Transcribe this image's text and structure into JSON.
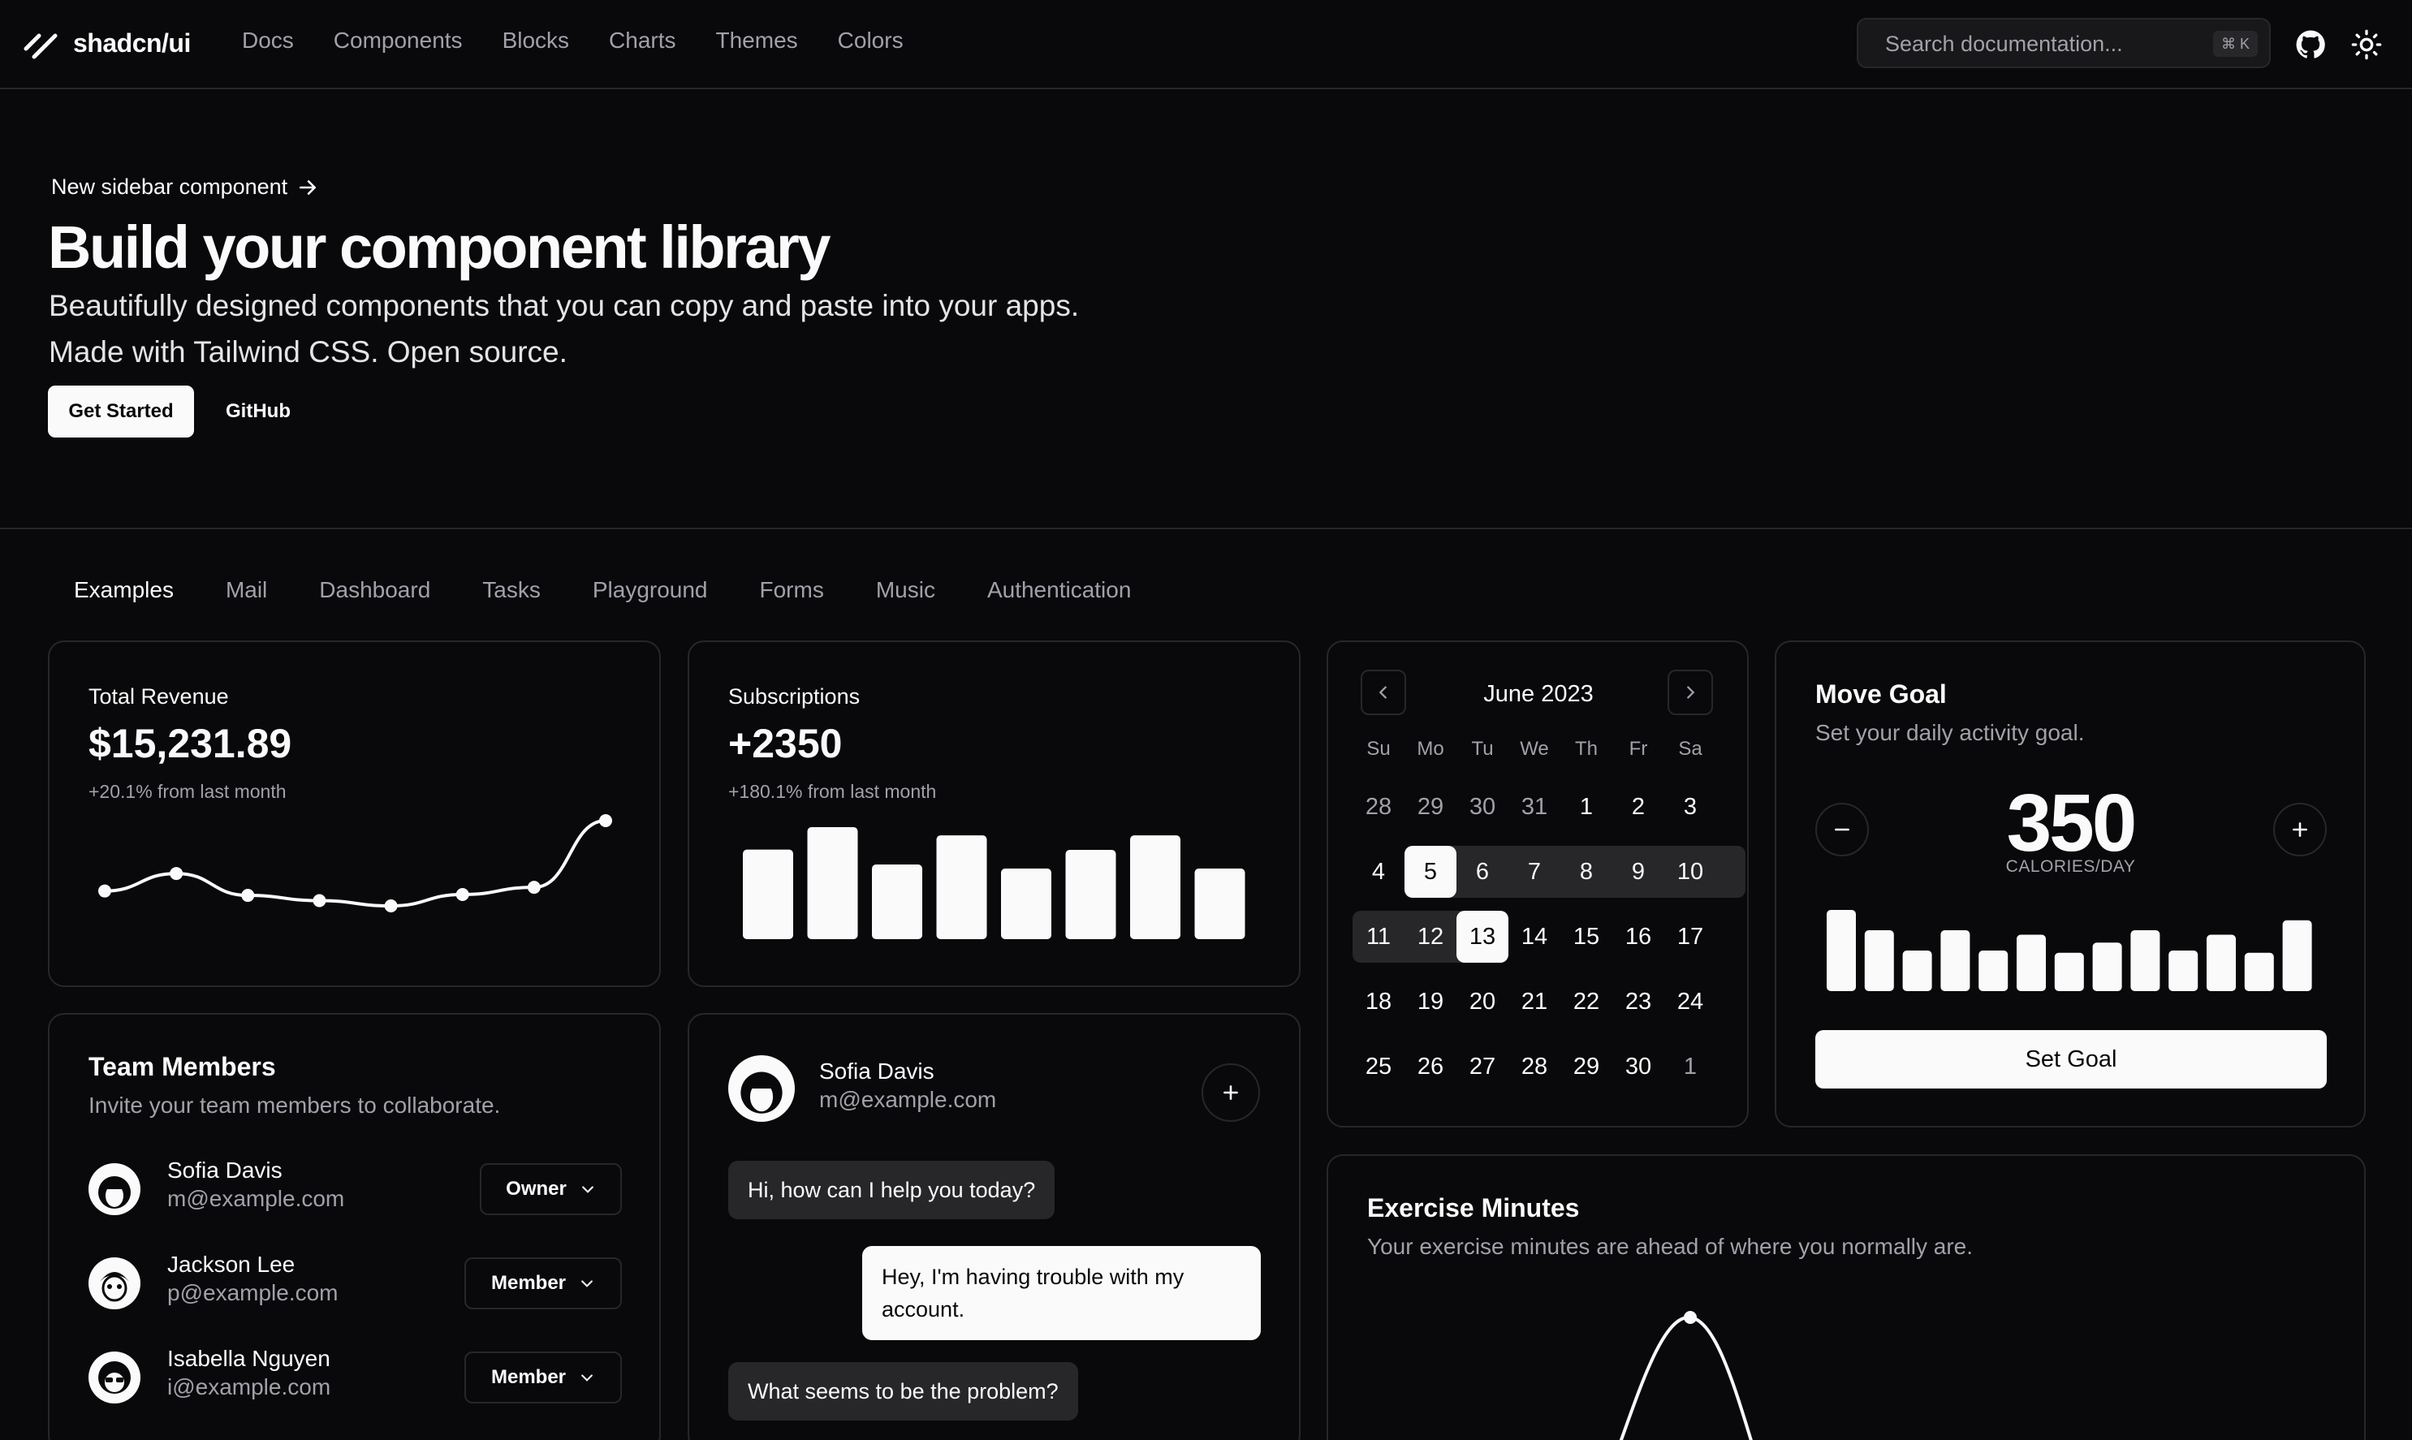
{
  "header": {
    "logo_text": "shadcn/ui",
    "nav": [
      "Docs",
      "Components",
      "Blocks",
      "Charts",
      "Themes",
      "Colors"
    ],
    "search_placeholder": "Search documentation...",
    "search_shortcut": "⌘ K"
  },
  "hero": {
    "announcement": "New sidebar component",
    "title": "Build your component library",
    "subtitle_line1": "Beautifully designed components that you can copy and paste into your apps.",
    "subtitle_line2": "Made with Tailwind CSS. Open source.",
    "primary_button": "Get Started",
    "secondary_button": "GitHub"
  },
  "tabs": [
    "Examples",
    "Mail",
    "Dashboard",
    "Tasks",
    "Playground",
    "Forms",
    "Music",
    "Authentication"
  ],
  "revenue": {
    "label": "Total Revenue",
    "value": "$15,231.89",
    "change": "+20.1% from last month"
  },
  "subscriptions": {
    "label": "Subscriptions",
    "value": "+2350",
    "change": "+180.1% from last month"
  },
  "calendar": {
    "month": "June 2023",
    "weekdays": [
      "Su",
      "Mo",
      "Tu",
      "We",
      "Th",
      "Fr",
      "Sa"
    ],
    "weeks": [
      [
        "28",
        "29",
        "30",
        "31",
        "1",
        "2",
        "3"
      ],
      [
        "4",
        "5",
        "6",
        "7",
        "8",
        "9",
        "10"
      ],
      [
        "11",
        "12",
        "13",
        "14",
        "15",
        "16",
        "17"
      ],
      [
        "18",
        "19",
        "20",
        "21",
        "22",
        "23",
        "24"
      ],
      [
        "25",
        "26",
        "27",
        "28",
        "29",
        "30",
        "1"
      ]
    ]
  },
  "move_goal": {
    "title": "Move Goal",
    "description": "Set your daily activity goal.",
    "value": "350",
    "unit": "CALORIES/DAY",
    "button": "Set Goal"
  },
  "team": {
    "title": "Team Members",
    "description": "Invite your team members to collaborate.",
    "members": [
      {
        "name": "Sofia Davis",
        "email": "m@example.com",
        "role": "Owner"
      },
      {
        "name": "Jackson Lee",
        "email": "p@example.com",
        "role": "Member"
      },
      {
        "name": "Isabella Nguyen",
        "email": "i@example.com",
        "role": "Member"
      }
    ]
  },
  "chat": {
    "name": "Sofia Davis",
    "email": "m@example.com",
    "messages": [
      {
        "from": "agent",
        "text": "Hi, how can I help you today?"
      },
      {
        "from": "user",
        "text": "Hey, I'm having trouble with my account."
      },
      {
        "from": "agent",
        "text": "What seems to be the problem?"
      }
    ]
  },
  "exercise": {
    "title": "Exercise Minutes",
    "description": "Your exercise minutes are ahead of where you normally are."
  },
  "chart_data": [
    {
      "type": "line",
      "chart": "revenue",
      "values": [
        10400,
        14405,
        9400,
        8200,
        7000,
        9600,
        11244,
        26475
      ]
    },
    {
      "type": "bar",
      "chart": "subscriptions",
      "values": [
        240,
        300,
        200,
        278,
        189,
        239,
        278,
        189
      ]
    },
    {
      "type": "bar",
      "chart": "move_goal",
      "values": [
        400,
        300,
        200,
        300,
        200,
        278,
        189,
        239,
        300,
        200,
        278,
        189,
        349
      ]
    }
  ]
}
